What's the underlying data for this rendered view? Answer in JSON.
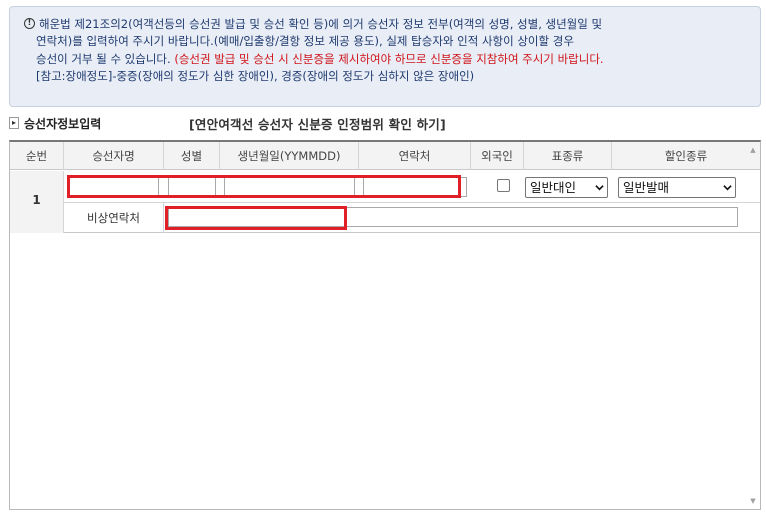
{
  "notice": {
    "line1": "해운법 제21조의2(여객선등의 승선권 발급 및 승선 확인 등)에 의거 승선자 정보 전부(여객의 성명, 성별, 생년월일 및",
    "line2": "연락처)를 입력하여 주시기 바랍니다.(예매/입출항/결항 정보 제공 용도), 실제 탑승자와 인적 사항이 상이할 경우",
    "line3_normal": "승선이 거부 될 수 있습니다.",
    "line3_red": "(승선권 발급 및 승선 시 신분증을 제시하여야 하므로 신분증을 지참하여 주시기 바랍니다.",
    "line4": "[참고:장애정도]-중증(장애의 정도가 심한 장애인), 경증(장애의 정도가 심하지 않은 장애인)"
  },
  "section": {
    "title": "승선자정보입력",
    "link": "[연안여객선 승선자 신분증 인정범위 확인 하기]"
  },
  "table": {
    "headers": [
      "순번",
      "승선자명",
      "성별",
      "생년월일(YYMMDD)",
      "연락처",
      "외국인",
      "표종류",
      "할인종류"
    ],
    "row": {
      "seq": "1",
      "ticket_type": "일반대인",
      "discount_type": "일반발매",
      "emergency_label": "비상연락처"
    }
  },
  "colors": {
    "highlight": "#e11f26",
    "notice_bg": "#e9eef6",
    "notice_text": "#1f3a6f",
    "warning_text": "#d0131a"
  }
}
